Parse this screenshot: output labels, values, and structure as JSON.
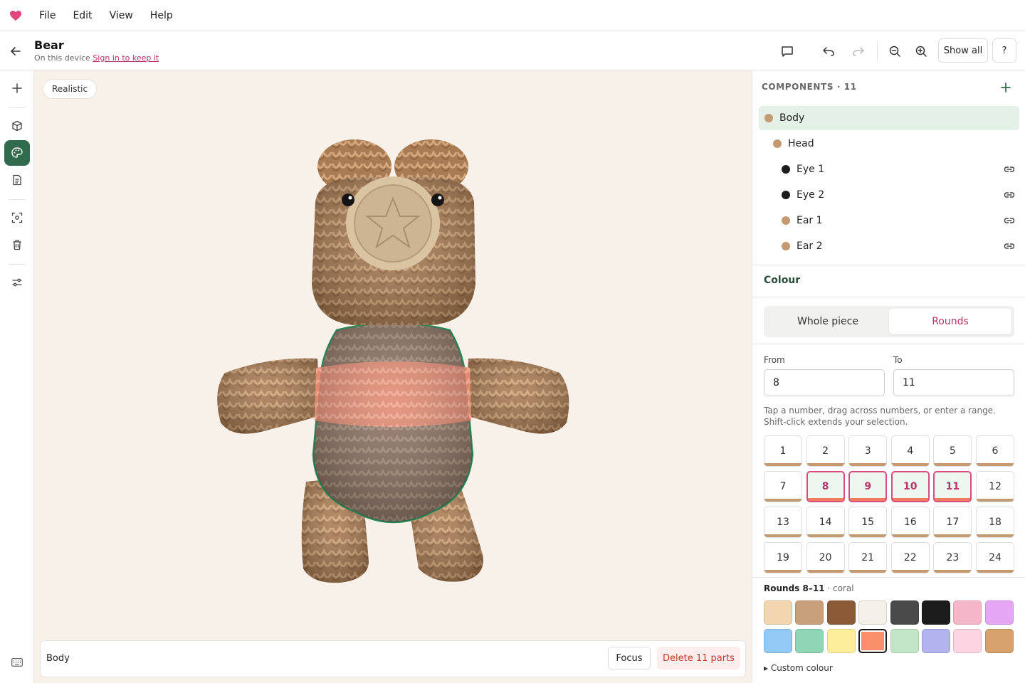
{
  "menu": {
    "items": [
      "File",
      "Edit",
      "View",
      "Help"
    ]
  },
  "document": {
    "title": "Bear",
    "subtitle": "On this device",
    "sign_in": "Sign in to keep it"
  },
  "toolbar": {
    "show_all": "Show all",
    "help": "?"
  },
  "viewport": {
    "mode_label": "Realistic",
    "selection_label": "Body",
    "focus_label": "Focus",
    "delete_label": "Delete 11 parts"
  },
  "components": {
    "header": "COMPONENTS · 11",
    "items": [
      {
        "label": "Body",
        "color": "#c49a72",
        "indent": 0,
        "selected": true,
        "linked": false
      },
      {
        "label": "Head",
        "color": "#c49a72",
        "indent": 1,
        "selected": false,
        "linked": false
      },
      {
        "label": "Eye 1",
        "color": "#1c1c1c",
        "indent": 2,
        "selected": false,
        "linked": true
      },
      {
        "label": "Eye 2",
        "color": "#1c1c1c",
        "indent": 2,
        "selected": false,
        "linked": true
      },
      {
        "label": "Ear 1",
        "color": "#c49a72",
        "indent": 2,
        "selected": false,
        "linked": true
      },
      {
        "label": "Ear 2",
        "color": "#c49a72",
        "indent": 2,
        "selected": false,
        "linked": true
      }
    ]
  },
  "colour": {
    "title": "Colour",
    "mode_whole": "Whole piece",
    "mode_rounds": "Rounds",
    "from_label": "From",
    "from_value": "8",
    "to_label": "To",
    "to_value": "11",
    "hint": "Tap a number, drag across numbers, or enter a range. Shift-click extends your selection.",
    "rounds": [
      "1",
      "2",
      "3",
      "4",
      "5",
      "6",
      "7",
      "8",
      "9",
      "10",
      "11",
      "12",
      "13",
      "14",
      "15",
      "16",
      "17",
      "18",
      "19",
      "20",
      "21",
      "22",
      "23",
      "24"
    ],
    "selected_rounds": [
      "8",
      "9",
      "10",
      "11"
    ],
    "selection_title": "Rounds 8–11",
    "selection_colour": "· coral",
    "swatches": [
      "#f2d6b0",
      "#c9a07c",
      "#8b5a36",
      "#f4f1ea",
      "#4a4a4a",
      "#1c1c1c",
      "#f4b6c8",
      "#e4a6f5",
      "#93c9f5",
      "#8fd5b6",
      "#fcee9a",
      "#f98f6a",
      "#c2e4c7",
      "#b3b3f0",
      "#fbd3e1",
      "#d8a26f"
    ],
    "selected_swatch": 11,
    "custom_label": "▸ Custom colour"
  },
  "colors": {
    "accent": "#2f6b4c",
    "brand": "#e0457b",
    "bear_yarn": "#b07e52",
    "stripe": "#ef8b72"
  }
}
